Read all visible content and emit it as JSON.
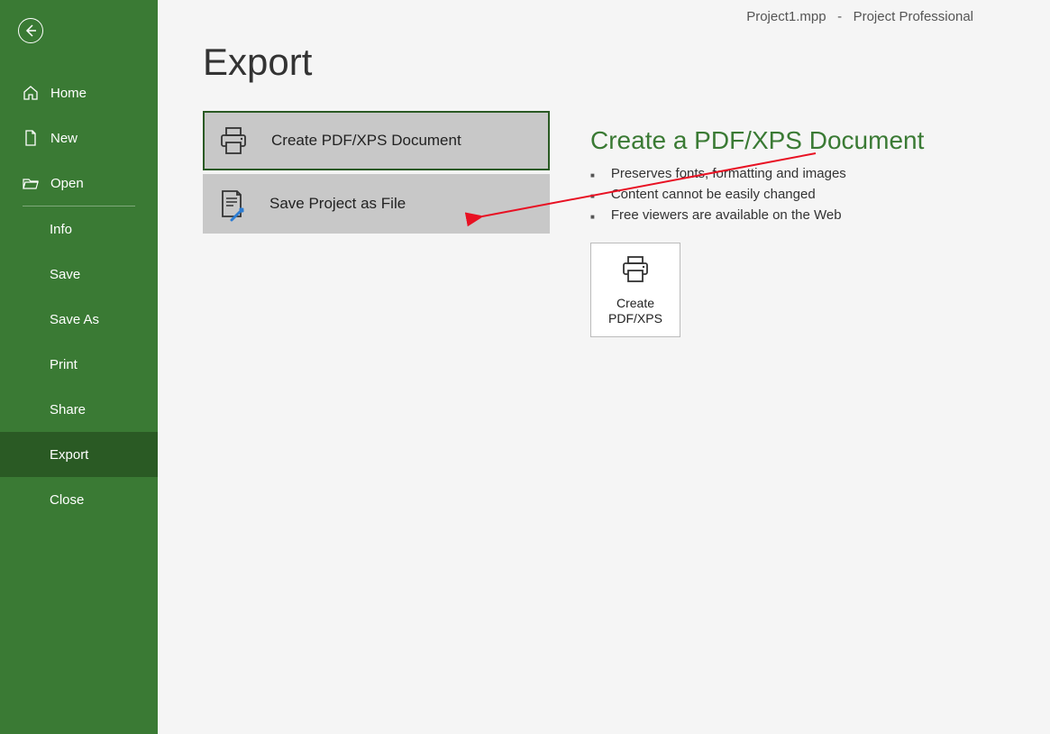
{
  "window": {
    "title_left": "Project1.mpp",
    "title_sep": "-",
    "title_right": "Project Professional"
  },
  "sidebar": {
    "top_items": [
      {
        "label": "Home"
      },
      {
        "label": "New"
      },
      {
        "label": "Open"
      }
    ],
    "bottom_items": [
      {
        "label": "Info"
      },
      {
        "label": "Save"
      },
      {
        "label": "Save As"
      },
      {
        "label": "Print"
      },
      {
        "label": "Share"
      },
      {
        "label": "Export"
      },
      {
        "label": "Close"
      }
    ]
  },
  "main": {
    "page_title": "Export",
    "options": [
      {
        "label": "Create PDF/XPS Document"
      },
      {
        "label": "Save Project as File"
      }
    ],
    "detail": {
      "title": "Create a PDF/XPS Document",
      "bullets": [
        "Preserves fonts, formatting and images",
        "Content cannot be easily changed",
        "Free viewers are available on the Web"
      ],
      "action_label": "Create\nPDF/XPS"
    }
  }
}
